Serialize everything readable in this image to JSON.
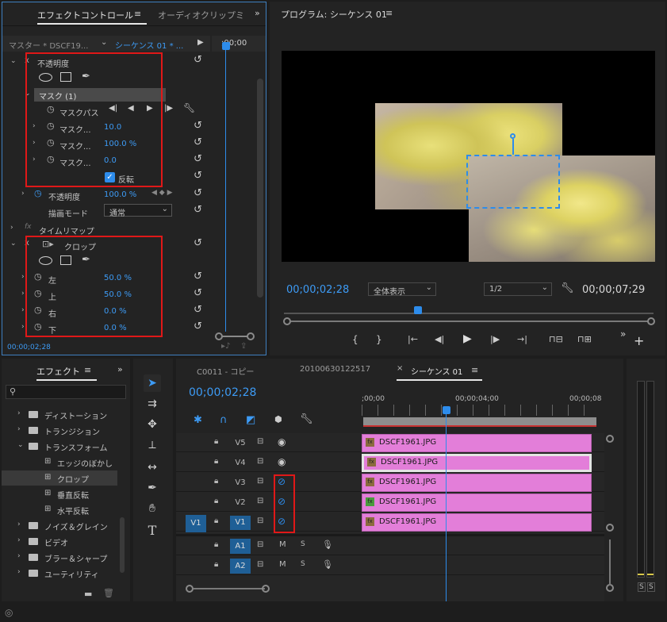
{
  "effect_controls": {
    "tabs": [
      "エフェクトコントロール",
      "オーディオクリップミ"
    ],
    "master_label": "マスター * DSCF19...",
    "sequence_label": "シーケンス 01 * ...",
    "ruler_time": ";00;00",
    "opacity_header": "不透明度",
    "mask_label": "マスク (1)",
    "mask_path_label": "マスクパス",
    "mask_feather_label": "マスク...",
    "mask_feather_value": "10.0",
    "mask_opacity_label": "マスク...",
    "mask_opacity_value": "100.0 %",
    "mask_expansion_label": "マスク...",
    "mask_expansion_value": "0.0",
    "inverted_label": "反転",
    "opacity_label": "不透明度",
    "opacity_value": "100.0 %",
    "blend_mode_label": "描画モード",
    "blend_mode_value": "通常",
    "time_remap_label": "タイムリマップ",
    "crop_label": "クロップ",
    "crop_left_label": "左",
    "crop_left_value": "50.0 %",
    "crop_top_label": "上",
    "crop_top_value": "50.0 %",
    "crop_right_label": "右",
    "crop_right_value": "0.0 %",
    "crop_bottom_label": "下",
    "crop_bottom_value": "0.0 %",
    "footer_time": "00;00;02;28"
  },
  "program_monitor": {
    "title": "プログラム: シーケンス 01",
    "current_time": "00;00;02;28",
    "zoom_value": "全体表示",
    "resolution_value": "1/2",
    "duration": "00;00;07;29"
  },
  "effects_panel": {
    "title": "エフェクト",
    "items": [
      {
        "label": "ディストーション",
        "type": "folder"
      },
      {
        "label": "トランジション",
        "type": "folder"
      },
      {
        "label": "トランスフォーム",
        "type": "folder-open"
      },
      {
        "label": "エッジのぼかし",
        "type": "effect"
      },
      {
        "label": "クロップ",
        "type": "effect-selected"
      },
      {
        "label": "垂直反転",
        "type": "effect"
      },
      {
        "label": "水平反転",
        "type": "effect"
      },
      {
        "label": "ノイズ＆グレイン",
        "type": "folder"
      },
      {
        "label": "ビデオ",
        "type": "folder"
      },
      {
        "label": "ブラー＆シャープ",
        "type": "folder"
      },
      {
        "label": "ユーティリティ",
        "type": "folder"
      }
    ]
  },
  "timeline": {
    "tabs": [
      "C0011 - コピー",
      "20100630122517",
      "シーケンス 01"
    ],
    "current_time": "00;00;02;28",
    "ruler": [
      ";00;00",
      "00;00;04;00",
      "00;00;08"
    ],
    "video_tracks": [
      {
        "name": "V5",
        "clip": "DSCF1961.JPG",
        "fx": "fx"
      },
      {
        "name": "V4",
        "clip": "DSCF1961.JPG",
        "fx": "fx"
      },
      {
        "name": "V3",
        "clip": "DSCF1961.JPG",
        "fx": "fx"
      },
      {
        "name": "V2",
        "clip": "DSCF1961.JPG",
        "fx": "fx"
      },
      {
        "name": "V1",
        "clip": "DSCF1961.JPG",
        "fx": "fx"
      }
    ],
    "source_patch": "V1",
    "audio_tracks": [
      {
        "name": "A1",
        "m": "M",
        "s": "S"
      },
      {
        "name": "A2",
        "m": "M",
        "s": "S"
      }
    ]
  },
  "meter": {
    "labels": [
      "S",
      "S"
    ]
  },
  "colors": {
    "accent": "#2d8ceb",
    "clip": "#e37ed9",
    "highlight_red": "#e01818"
  }
}
